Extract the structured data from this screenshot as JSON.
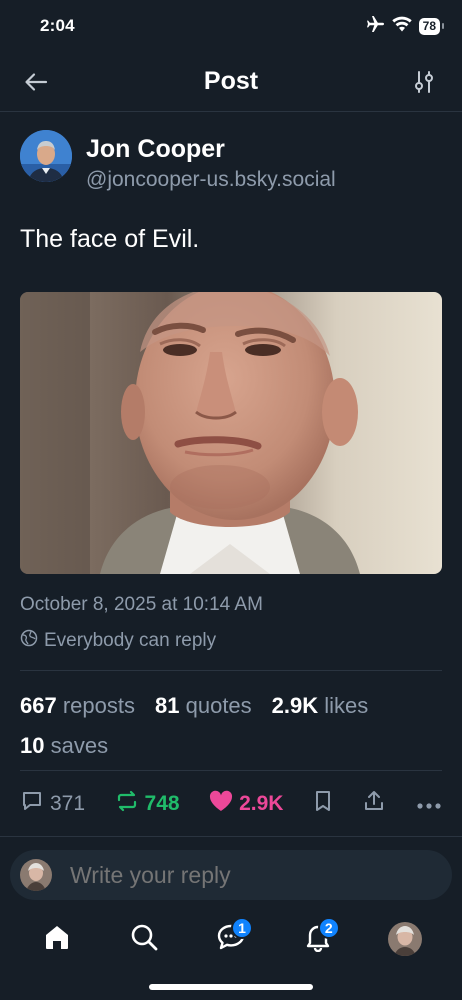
{
  "status_bar": {
    "time": "2:04",
    "battery": "78"
  },
  "header": {
    "title": "Post"
  },
  "author": {
    "name": "Jon Cooper",
    "handle": "@joncooper-us.bsky.social"
  },
  "post": {
    "text": "The face of Evil.",
    "date": "October 8, 2025 at 10:14 AM",
    "reply_setting": "Everybody can reply"
  },
  "stats": {
    "reposts": {
      "count": "667",
      "label": "reposts"
    },
    "quotes": {
      "count": "81",
      "label": "quotes"
    },
    "likes": {
      "count": "2.9K",
      "label": "likes"
    },
    "saves": {
      "count": "10",
      "label": "saves"
    }
  },
  "actions": {
    "replies": "371",
    "reposts": "748",
    "likes": "2.9K"
  },
  "compose": {
    "placeholder": "Write your reply"
  },
  "tabs": {
    "messages_badge": "1",
    "notifications_badge": "2"
  },
  "colors": {
    "background": "#161e27",
    "muted": "#8e9bab",
    "repost": "#20bc6a",
    "like": "#ec4899",
    "badge": "#1083fe"
  }
}
